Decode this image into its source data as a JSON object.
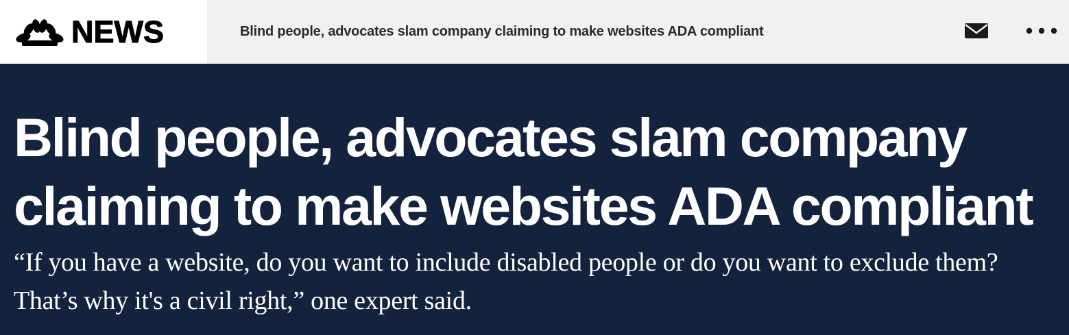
{
  "brand": {
    "logo_icon": "peacock-logo-icon",
    "wordmark": "NEWS"
  },
  "topbar": {
    "article_title": "Blind people, advocates slam company claiming to make websites ADA compliant",
    "mail_icon": "envelope-icon",
    "more_icon": "more-dots-icon"
  },
  "article": {
    "headline": "Blind people, advocates slam company claiming to make websites ADA compliant",
    "dek": "“If you have a website, do you want to include disabled people or do you want to exclude them? That’s why it's a civil right,” one expert said."
  },
  "colors": {
    "hero_background": "#13223d",
    "topbar_background": "#f1f1f1",
    "brand_background": "#ffffff",
    "headline_text": "#ffffff"
  }
}
